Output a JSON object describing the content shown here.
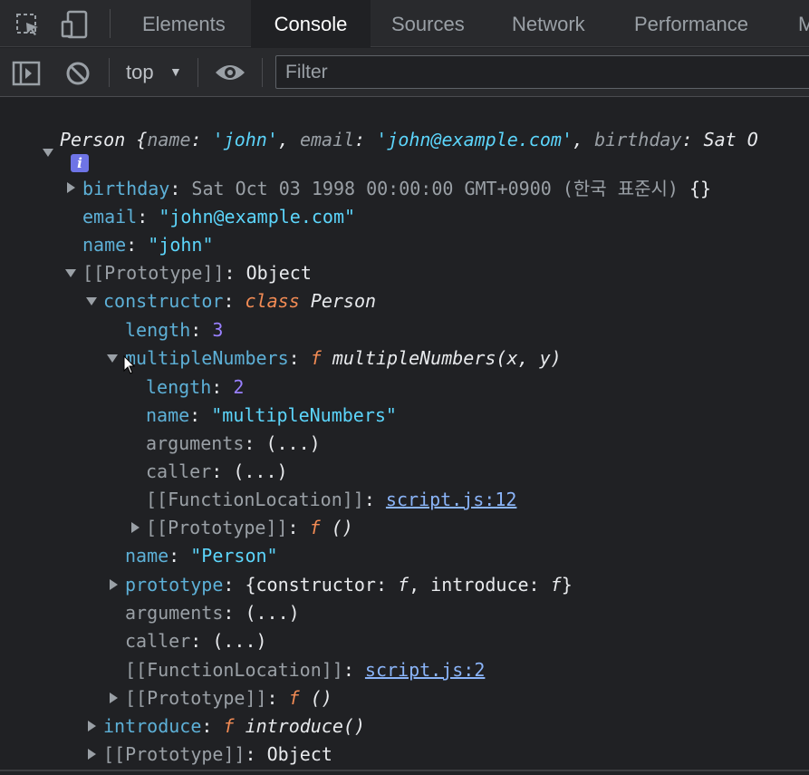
{
  "tabs": {
    "elements": "Elements",
    "console": "Console",
    "sources": "Sources",
    "network": "Network",
    "performance": "Performance",
    "more": "M"
  },
  "toolbar": {
    "context": "top",
    "filter_placeholder": "Filter"
  },
  "icons": {
    "inspect": "inspect-element-icon",
    "device": "device-toolbar-icon",
    "sidebar": "show-sidebar-icon",
    "clear": "clear-console-icon",
    "eye": "live-expression-icon",
    "dropdown": "dropdown-arrow-icon",
    "info": "info-icon",
    "pointer": "mouse-pointer-icon"
  },
  "console": {
    "summary": {
      "class": "Person",
      "open": " {",
      "k_name": "name",
      "v_name": "'john'",
      "k_email": "email",
      "v_email": "'john@example.com'",
      "k_birthday": "birthday",
      "v_birthday": "Sat O",
      "colon": ": ",
      "comma": ", "
    },
    "info_glyph": "i",
    "birthday": {
      "key": "birthday",
      "value": "Sat Oct 03 1998 00:00:00 GMT+0900 (한국 표준시)",
      "tail": "{}"
    },
    "email": {
      "key": "email",
      "value": "\"john@example.com\""
    },
    "name": {
      "key": "name",
      "value": "\"john\""
    },
    "proto1": {
      "key": "[[Prototype]]",
      "value": "Object"
    },
    "constructor": {
      "key": "constructor",
      "kw": "class",
      "value": "Person"
    },
    "length1": {
      "key": "length",
      "value": "3"
    },
    "multipleNumbers": {
      "key": "multipleNumbers",
      "f": "f",
      "value": "multipleNumbers(x, y)"
    },
    "length2": {
      "key": "length",
      "value": "2"
    },
    "name2": {
      "key": "name",
      "value": "\"multipleNumbers\""
    },
    "arguments1": {
      "key": "arguments",
      "value": "(...)"
    },
    "caller1": {
      "key": "caller",
      "value": "(...)"
    },
    "loc1": {
      "key": "[[FunctionLocation]]",
      "value": "script.js:12"
    },
    "proto2": {
      "key": "[[Prototype]]",
      "f": "f",
      "value": "()"
    },
    "name3": {
      "key": "name",
      "value": "\"Person\""
    },
    "prototype": {
      "key": "prototype",
      "open": "{constructor: ",
      "f1": "f",
      "mid": ", introduce: ",
      "f2": "f",
      "close": "}"
    },
    "arguments2": {
      "key": "arguments",
      "value": "(...)"
    },
    "caller2": {
      "key": "caller",
      "value": "(...)"
    },
    "loc2": {
      "key": "[[FunctionLocation]]",
      "value": "script.js:2"
    },
    "proto3": {
      "key": "[[Prototype]]",
      "f": "f",
      "value": "()"
    },
    "introduce": {
      "key": "introduce",
      "f": "f",
      "value": "introduce()"
    },
    "proto4": {
      "key": "[[Prototype]]",
      "value": "Object"
    }
  }
}
